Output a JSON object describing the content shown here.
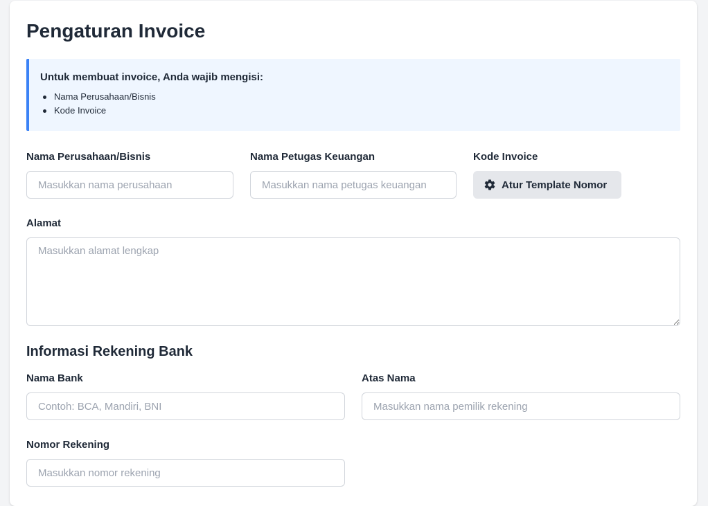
{
  "page": {
    "title": "Pengaturan Invoice"
  },
  "info": {
    "title": "Untuk membuat invoice, Anda wajib mengisi:",
    "items": [
      "Nama Perusahaan/Bisnis",
      "Kode Invoice"
    ]
  },
  "company": {
    "name_label": "Nama Perusahaan/Bisnis",
    "name_placeholder": "Masukkan nama perusahaan",
    "name_value": "",
    "officer_label": "Nama Petugas Keuangan",
    "officer_placeholder": "Masukkan nama petugas keuangan",
    "officer_value": "",
    "code_label": "Kode Invoice",
    "template_button_label": "Atur Template Nomor",
    "template_button_icon": "gear-icon"
  },
  "address": {
    "label": "Alamat",
    "placeholder": "Masukkan alamat lengkap",
    "value": ""
  },
  "bank": {
    "section_title": "Informasi Rekening Bank",
    "bank_name_label": "Nama Bank",
    "bank_name_placeholder": "Contoh: BCA, Mandiri, BNI",
    "holder_label": "Atas Nama",
    "holder_placeholder": "Masukkan nama pemilik rekening",
    "account_label": "Nomor Rekening",
    "account_placeholder": "Masukkan nomor rekening"
  },
  "colors": {
    "accent": "#3b82f6",
    "info_bg": "#eff6ff",
    "button_bg": "#e5e7eb",
    "text": "#1f2937",
    "placeholder": "#9ca3af"
  }
}
